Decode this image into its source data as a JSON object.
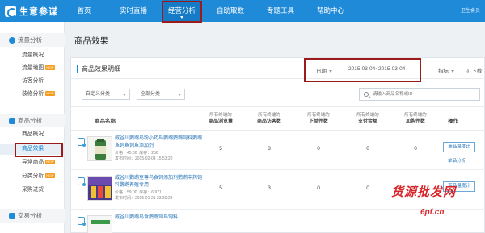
{
  "brand": {
    "name": "生意参谋"
  },
  "nav": {
    "items": [
      "首页",
      "实时直播",
      "经营分析",
      "自助取数",
      "专题工具",
      "帮助中心"
    ],
    "active_index": 2,
    "account": "卫生会员"
  },
  "sidebar": {
    "sections": [
      {
        "title": "流量分析",
        "items": [
          {
            "label": "流量概况",
            "new": false
          },
          {
            "label": "流量地图",
            "new": true
          },
          {
            "label": "访客分析",
            "new": false
          },
          {
            "label": "装修分析",
            "new": true
          }
        ]
      },
      {
        "title": "商品分析",
        "items": [
          {
            "label": "商品概况",
            "new": false
          },
          {
            "label": "商品效果",
            "new": false
          },
          {
            "label": "异常商品",
            "new": true
          },
          {
            "label": "分类分析",
            "new": true
          },
          {
            "label": "采购进货",
            "new": false
          }
        ]
      },
      {
        "title": "交易分析",
        "items": []
      }
    ],
    "new_tag": "NEW"
  },
  "page": {
    "title": "商品效果"
  },
  "card": {
    "title": "商品效果明细",
    "date_label": "日期",
    "date_range": "2015-03-04~2015-03-04",
    "metric_label": "指标",
    "download_label": "下载"
  },
  "filters": {
    "category": "自定义分类",
    "all": "全部分类",
    "search_placeholder": "请输入商品名称或ID"
  },
  "table": {
    "name_header": "商品名称",
    "op_header": "操作",
    "metric_headers": [
      {
        "prefix": "所有终端的",
        "label": "商品浏览量"
      },
      {
        "prefix": "所有终端的",
        "label": "商品访客数"
      },
      {
        "prefix": "所有终端的",
        "label": "下单件数"
      },
      {
        "prefix": "所有终端的",
        "label": "支付金额"
      },
      {
        "prefix": "所有终端的",
        "label": "加购件数"
      }
    ],
    "rows": [
      {
        "title": "威谷川鹦鹉鸟粉小药鸟鹦鹉鹦鹉饲料鹦鹉鱼饲鱼饲鱼添加剂",
        "price": "价格：45.00",
        "stock": "库存：256",
        "published": "发布时间：2015-02-04 15:53:20",
        "values": [
          "5",
          "3",
          "0",
          "0",
          "0"
        ],
        "op_button": "商品温度计",
        "op_link": "单品分析"
      },
      {
        "title": "威谷川鹦鹉至尊鸟食饲添加剂鹦鹉中药饲料鹦鹉养殖专用",
        "price": "价格：59.00",
        "stock": "库存：6,971",
        "published": "发布时间：2015-01-21 23:30:23",
        "values": [
          "5",
          "3",
          "0",
          "0",
          "0"
        ],
        "op_button": "商品温度计",
        "op_link": ""
      },
      {
        "title": "威谷川鹦鹉鸟食鹦鹉饲鸟饲料",
        "price": "",
        "stock": "",
        "published": "",
        "values": [
          "",
          "",
          "",
          "",
          ""
        ],
        "op_button": "",
        "op_link": ""
      }
    ]
  },
  "watermark": {
    "line1": "货源批发网",
    "line2": "6pf.cn"
  },
  "colors": {
    "brand_blue": "#1f8ad8",
    "nav_active": "#157bc6",
    "highlight_red": "#9b1b1b",
    "new_tag": "#f59c1a"
  }
}
